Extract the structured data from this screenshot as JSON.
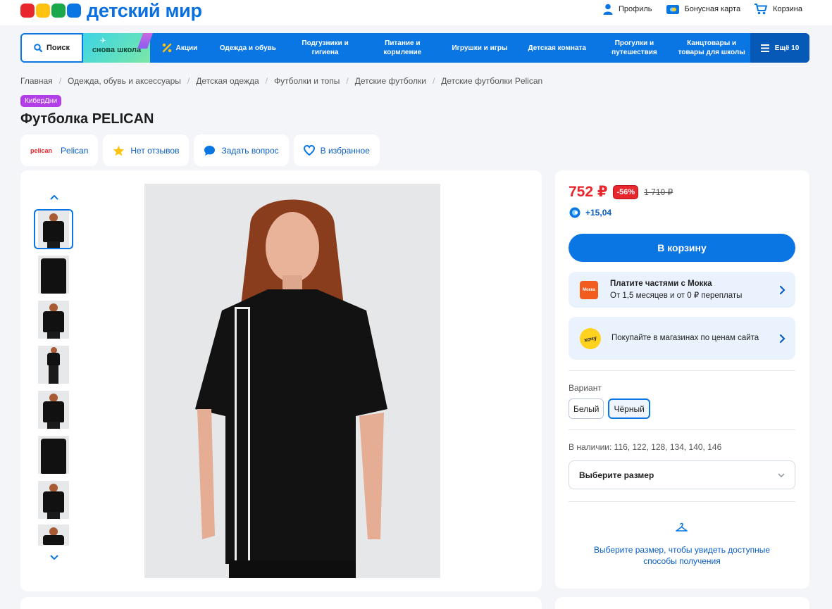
{
  "brand": {
    "name": "детский мир",
    "colors": [
      "#e8262d",
      "#ffc20e",
      "#1aa84a",
      "#0a76e4"
    ]
  },
  "top_links": [
    {
      "label": "Профиль",
      "icon": "user-icon"
    },
    {
      "label": "Бонусная карта",
      "icon": "bonus-card-icon"
    },
    {
      "label": "Корзина",
      "icon": "cart-icon"
    }
  ],
  "nav": {
    "search_label": "Поиск",
    "promo_label": "снова школа",
    "sale_label": "Акции",
    "items": [
      "Одежда и обувь",
      "Подгузники и гигиена",
      "Питание и кормление",
      "Игрушки и игры",
      "Детская комната",
      "Прогулки и путешествия",
      "Канцтовары и товары для школы"
    ],
    "more_label": "Ещё 10"
  },
  "breadcrumb": [
    "Главная",
    "Одежда, обувь и аксессуары",
    "Детская одежда",
    "Футболки и топы",
    "Детские футболки",
    "Детские футболки Pelican"
  ],
  "product": {
    "badge": "КиберДни",
    "title": "Футболка PELICAN",
    "brand_logo": "pelican",
    "brand_name": "Pelican",
    "reviews": "Нет отзывов",
    "ask": "Задать вопрос",
    "favorite": "В избранное"
  },
  "buy": {
    "price": "752 ₽",
    "discount": "-56%",
    "old_price": "1 710 ₽",
    "bonus": "+15,04",
    "cart_button": "В корзину",
    "mokka": {
      "logo": "Мокка",
      "title": "Платите частями с Мокка",
      "subtitle": "От 1,5 месяцев и от 0 ₽ переплаты"
    },
    "hochu": {
      "logo": "хочу",
      "text": "Покупайте в магазинах по ценам сайта"
    },
    "variant_label": "Вариант",
    "variants": [
      {
        "label": "Белый",
        "selected": false
      },
      {
        "label": "Чёрный",
        "selected": true
      }
    ],
    "stock": "В наличии: 116, 122, 128, 134, 140, 146",
    "size_placeholder": "Выберите размер",
    "delivery_text": "Выберите размер, чтобы увидеть доступные способы получения"
  },
  "accent_color": "#0a76e4",
  "price_color": "#e8262d"
}
